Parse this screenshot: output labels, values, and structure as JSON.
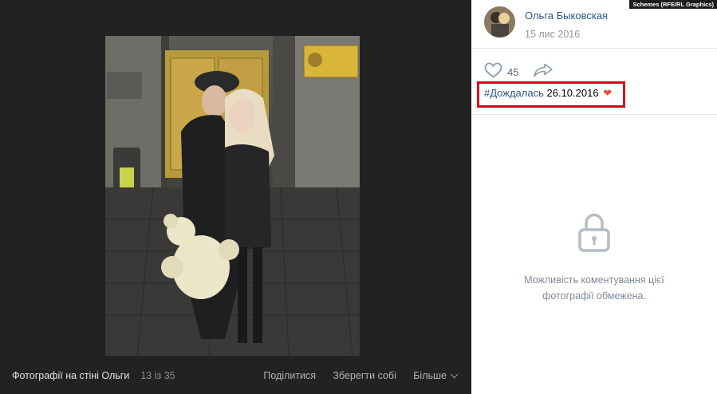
{
  "viewer": {
    "caption": "Фотографії на стіні Ольги",
    "counter": "13 із 35",
    "actions": {
      "share": "Поділитися",
      "save": "Зберегти собі",
      "more": "Більше"
    }
  },
  "watermark": "Schemes (RFE/RL Graphics)",
  "author": {
    "name": "Ольга Быковская",
    "date": "15 лис 2016"
  },
  "likes": {
    "count": "45",
    "icon": "heart-outline-icon",
    "share_icon": "share-arrow-icon"
  },
  "post": {
    "hashtag": "#Дождалась",
    "date_text": "26.10.2016",
    "emoji": "❤"
  },
  "comments": {
    "icon": "lock-icon",
    "message_line1": "Можливість коментування цієї",
    "message_line2": "фотографії обмежена."
  },
  "colors": {
    "link": "#2a5885",
    "highlight_border": "#e3001b",
    "viewer_bg": "#222222"
  }
}
